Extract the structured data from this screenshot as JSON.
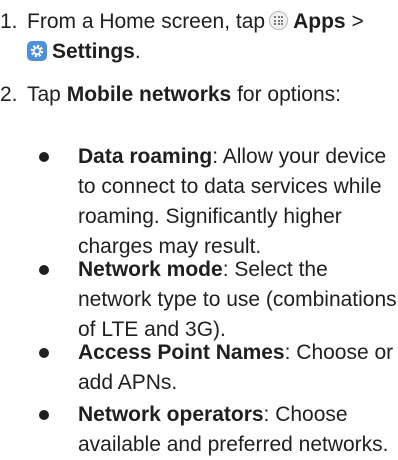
{
  "steps": [
    {
      "number": "1.",
      "text_before": "From a Home screen, tap",
      "apps_label": "Apps",
      "separator": ">",
      "settings_label": "Settings",
      "end": "."
    },
    {
      "number": "2.",
      "text_before": "Tap",
      "bold": "Mobile networks",
      "text_after": "for options:"
    }
  ],
  "options": [
    {
      "title": "Data roaming",
      "description": ": Allow your device to connect to data services while roaming. Significantly higher charges may result."
    },
    {
      "title": "Network mode",
      "description": ": Select the network type to use (combinations of LTE and 3G)."
    },
    {
      "title": "Access Point Names",
      "description": ": Choose or add APNs."
    },
    {
      "title": "Network operators",
      "description": ": Choose available and preferred networks."
    }
  ],
  "icons": {
    "apps": "apps-grid-icon",
    "settings": "settings-gear-icon"
  }
}
